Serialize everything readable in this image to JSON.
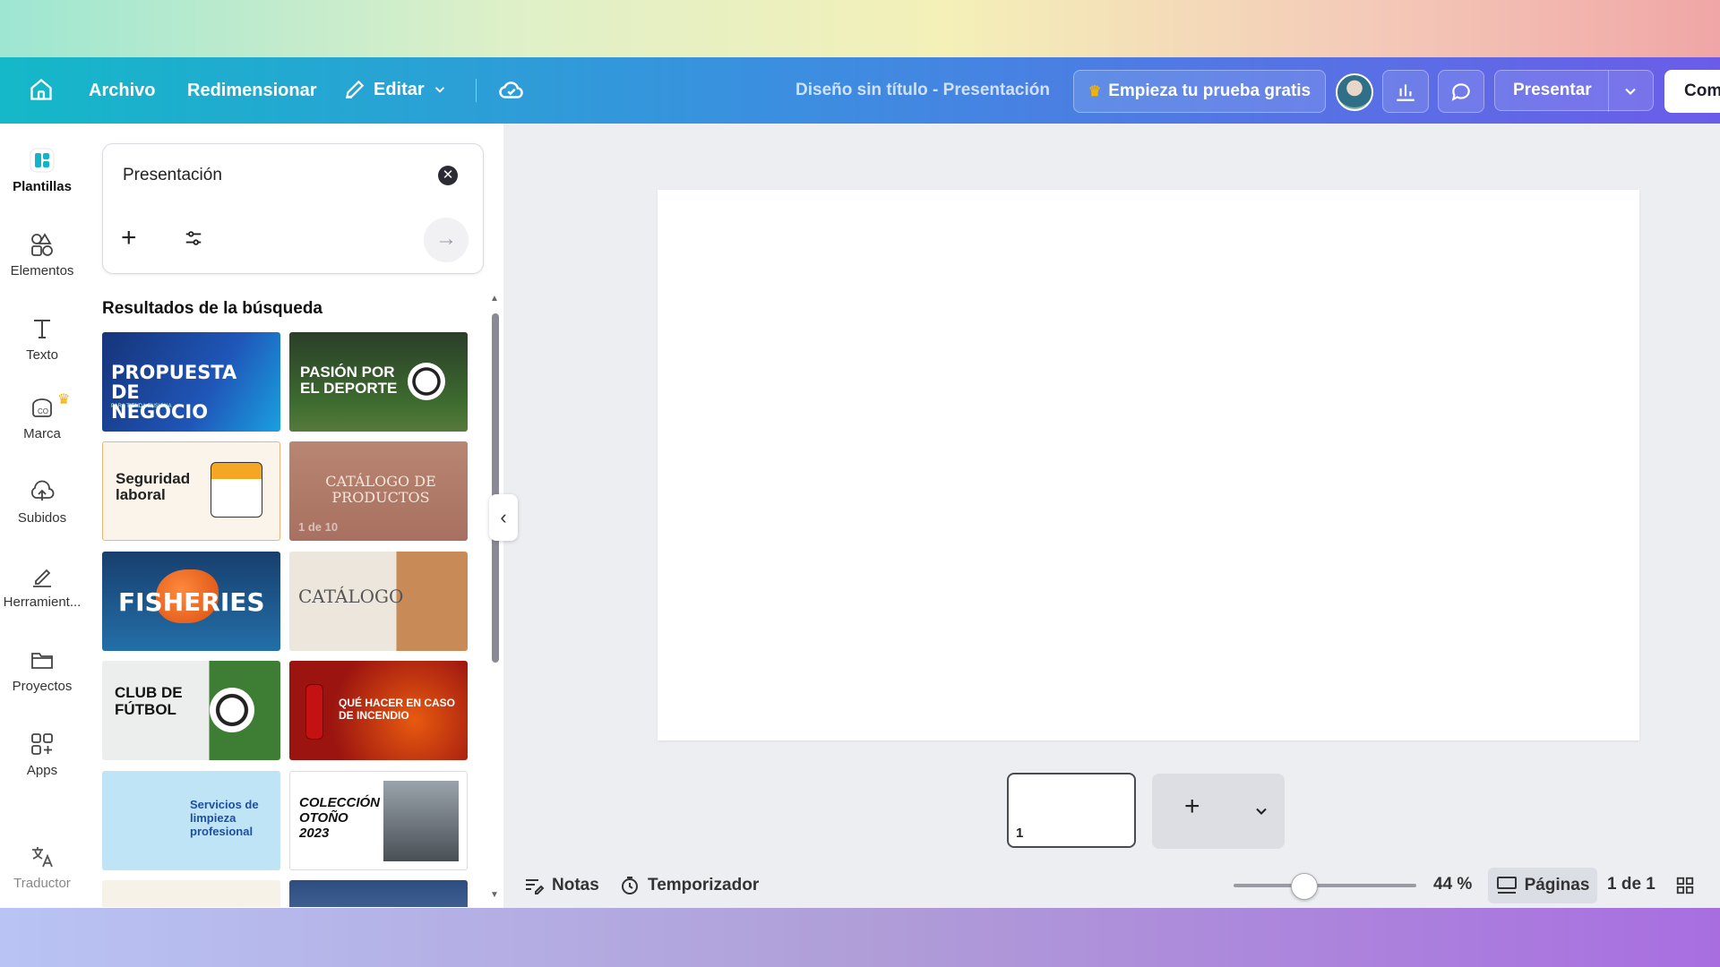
{
  "toolbar": {
    "home_icon": "home-icon",
    "archivo": "Archivo",
    "redimensionar": "Redimensionar",
    "editar": "Editar",
    "doc_title": "Diseño sin título - Presentación",
    "trial": "Empieza tu prueba gratis",
    "presentar": "Presentar",
    "share": "Com"
  },
  "rail": {
    "items": [
      {
        "label": "Plantillas",
        "icon": "templates-icon"
      },
      {
        "label": "Elementos",
        "icon": "elements-icon"
      },
      {
        "label": "Texto",
        "icon": "text-icon"
      },
      {
        "label": "Marca",
        "icon": "brand-icon"
      },
      {
        "label": "Subidos",
        "icon": "upload-icon"
      },
      {
        "label": "Herramient...",
        "icon": "tools-icon"
      },
      {
        "label": "Proyectos",
        "icon": "folder-icon"
      },
      {
        "label": "Apps",
        "icon": "apps-icon"
      },
      {
        "label": "Traductor",
        "icon": "translate-icon"
      }
    ]
  },
  "search": {
    "query": "Presentación",
    "results_title": "Resultados de la búsqueda"
  },
  "templates": [
    {
      "title": "PROPUESTA DE NEGOCIO",
      "sub": "PARA TIENDA ENSIGNA",
      "bg": "#1b3f8c"
    },
    {
      "title": "PASIÓN POR EL DEPORTE",
      "sub": "",
      "bg": "#2d4d2a"
    },
    {
      "title": "Seguridad laboral",
      "sub": "",
      "bg": "#fbf4ea"
    },
    {
      "title": "CATÁLOGO DE PRODUCTOS",
      "sub": "1 de 10",
      "bg": "#b88672"
    },
    {
      "title": "FISHERIES",
      "sub": "",
      "bg": "#1d5a8c"
    },
    {
      "title": "CATÁLOGO",
      "sub": "",
      "bg": "#ebe4da"
    },
    {
      "title": "CLUB DE FÚTBOL",
      "sub": "",
      "bg": "#e9ebea"
    },
    {
      "title": "QUÉ HACER EN CASO DE INCENDIO",
      "sub": "",
      "bg": "#9b1410"
    },
    {
      "title": "Servicios de limpieza profesional",
      "sub": "",
      "bg": "#bfe4f6"
    },
    {
      "title": "COLECCIÓN OTOÑO 2023",
      "sub": "",
      "bg": "#ffffff"
    }
  ],
  "footer": {
    "notas": "Notas",
    "temporizador": "Temporizador",
    "zoom": "44 %",
    "zoom_level": 0.44,
    "paginas": "Páginas",
    "page_count": "1 de 1",
    "page_num": "1"
  }
}
